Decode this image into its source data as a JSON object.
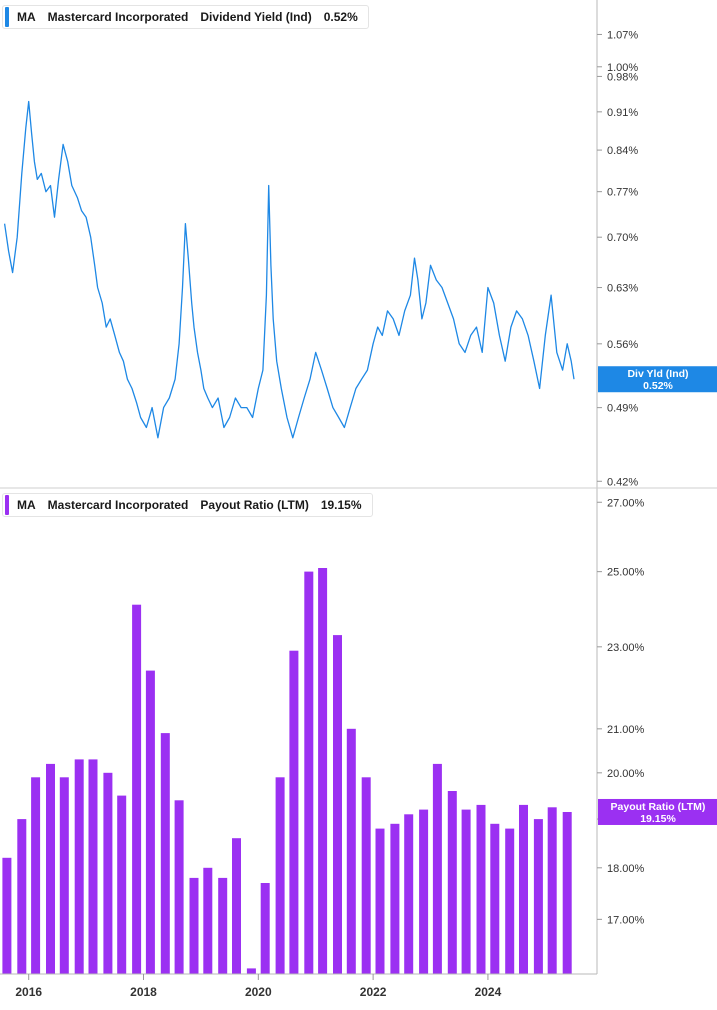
{
  "chart_data": [
    {
      "type": "line",
      "ticker": "MA",
      "company": "Mastercard Incorporated",
      "metric": "Dividend Yield (Ind)",
      "current_value": "0.52%",
      "badge_line1": "Div Yld (Ind)",
      "badge_line2": "0.52%",
      "color": "#1e88e5",
      "scale": "log",
      "ylim": [
        0.415,
        1.15
      ],
      "y_ticks": [
        "0.42%",
        "0.49%",
        "0.56%",
        "0.63%",
        "0.70%",
        "0.77%",
        "0.84%",
        "0.91%",
        "0.98%",
        "1.00%",
        "1.07%"
      ],
      "series": [
        {
          "x": [
            2015.58,
            2015.65,
            2015.72,
            2015.8,
            2015.88,
            2015.95,
            2016.0,
            2016.05,
            2016.1,
            2016.15,
            2016.22,
            2016.3,
            2016.38,
            2016.45,
            2016.52,
            2016.6,
            2016.68,
            2016.75,
            2016.85,
            2016.92,
            2017.0,
            2017.08,
            2017.15,
            2017.2,
            2017.28,
            2017.35,
            2017.42,
            2017.5,
            2017.58,
            2017.65,
            2017.72,
            2017.8,
            2017.88,
            2017.95,
            2018.05,
            2018.15,
            2018.25,
            2018.35,
            2018.45,
            2018.55,
            2018.62,
            2018.68,
            2018.73,
            2018.78,
            2018.84,
            2018.88,
            2018.94,
            2019.0,
            2019.05,
            2019.12,
            2019.2,
            2019.3,
            2019.4,
            2019.5,
            2019.6,
            2019.7,
            2019.8,
            2019.9,
            2020.0,
            2020.08,
            2020.14,
            2020.18,
            2020.22,
            2020.26,
            2020.32,
            2020.4,
            2020.5,
            2020.6,
            2020.7,
            2020.8,
            2020.9,
            2021.0,
            2021.1,
            2021.2,
            2021.3,
            2021.4,
            2021.5,
            2021.6,
            2021.7,
            2021.8,
            2021.9,
            2022.0,
            2022.08,
            2022.16,
            2022.25,
            2022.35,
            2022.45,
            2022.55,
            2022.65,
            2022.72,
            2022.78,
            2022.85,
            2022.92,
            2023.0,
            2023.1,
            2023.2,
            2023.3,
            2023.4,
            2023.5,
            2023.6,
            2023.7,
            2023.8,
            2023.9,
            2024.0,
            2024.1,
            2024.2,
            2024.3,
            2024.4,
            2024.5,
            2024.6,
            2024.7,
            2024.8,
            2024.9,
            2025.0,
            2025.1,
            2025.2,
            2025.3,
            2025.38,
            2025.45,
            2025.5
          ],
          "y": [
            0.72,
            0.68,
            0.65,
            0.7,
            0.8,
            0.88,
            0.93,
            0.87,
            0.82,
            0.79,
            0.8,
            0.77,
            0.78,
            0.73,
            0.79,
            0.85,
            0.82,
            0.78,
            0.76,
            0.74,
            0.73,
            0.7,
            0.66,
            0.63,
            0.61,
            0.58,
            0.59,
            0.57,
            0.55,
            0.54,
            0.52,
            0.51,
            0.495,
            0.48,
            0.47,
            0.49,
            0.46,
            0.49,
            0.5,
            0.52,
            0.56,
            0.63,
            0.72,
            0.67,
            0.61,
            0.58,
            0.55,
            0.53,
            0.51,
            0.5,
            0.49,
            0.5,
            0.47,
            0.48,
            0.5,
            0.49,
            0.49,
            0.48,
            0.51,
            0.53,
            0.62,
            0.78,
            0.66,
            0.59,
            0.54,
            0.51,
            0.48,
            0.46,
            0.48,
            0.5,
            0.52,
            0.55,
            0.53,
            0.51,
            0.49,
            0.48,
            0.47,
            0.49,
            0.51,
            0.52,
            0.53,
            0.56,
            0.58,
            0.57,
            0.6,
            0.59,
            0.57,
            0.6,
            0.62,
            0.67,
            0.64,
            0.59,
            0.61,
            0.66,
            0.64,
            0.63,
            0.61,
            0.59,
            0.56,
            0.55,
            0.57,
            0.58,
            0.55,
            0.63,
            0.61,
            0.57,
            0.54,
            0.58,
            0.6,
            0.59,
            0.57,
            0.54,
            0.51,
            0.57,
            0.62,
            0.55,
            0.53,
            0.56,
            0.54,
            0.52
          ]
        }
      ]
    },
    {
      "type": "bar",
      "ticker": "MA",
      "company": "Mastercard Incorporated",
      "metric": "Payout Ratio (LTM)",
      "current_value": "19.15%",
      "badge_line1": "Payout Ratio (LTM)",
      "badge_line2": "19.15%",
      "color": "#9b30f2",
      "scale": "log",
      "ylim": [
        16.0,
        27.4
      ],
      "y_ticks": [
        "17.00%",
        "18.00%",
        "19.00%",
        "20.00%",
        "21.00%",
        "23.00%",
        "25.00%",
        "27.00%"
      ],
      "x": [
        2015.62,
        2015.88,
        2016.12,
        2016.38,
        2016.62,
        2016.88,
        2017.12,
        2017.38,
        2017.62,
        2017.88,
        2018.12,
        2018.38,
        2018.62,
        2018.88,
        2019.12,
        2019.38,
        2019.62,
        2019.88,
        2020.12,
        2020.38,
        2020.62,
        2020.88,
        2021.12,
        2021.38,
        2021.62,
        2021.88,
        2022.12,
        2022.38,
        2022.62,
        2022.88,
        2023.12,
        2023.38,
        2023.62,
        2023.88,
        2024.12,
        2024.38,
        2024.62,
        2024.88,
        2025.12,
        2025.38
      ],
      "values": [
        18.2,
        19.0,
        19.9,
        20.2,
        19.9,
        20.3,
        20.3,
        20.0,
        19.5,
        24.1,
        22.4,
        20.9,
        19.4,
        17.8,
        18.0,
        17.8,
        18.6,
        16.1,
        17.7,
        19.9,
        22.9,
        25.0,
        25.1,
        23.3,
        21.0,
        19.9,
        18.8,
        18.9,
        19.1,
        19.2,
        20.2,
        19.6,
        19.2,
        19.3,
        18.9,
        18.8,
        19.3,
        19.0,
        19.25,
        19.15
      ]
    }
  ],
  "x_axis": {
    "xlim": [
      2015.5,
      2025.9
    ],
    "ticks": [
      2016,
      2018,
      2020,
      2022,
      2024
    ],
    "tick_labels": [
      "2016",
      "2018",
      "2020",
      "2022",
      "2024"
    ]
  }
}
